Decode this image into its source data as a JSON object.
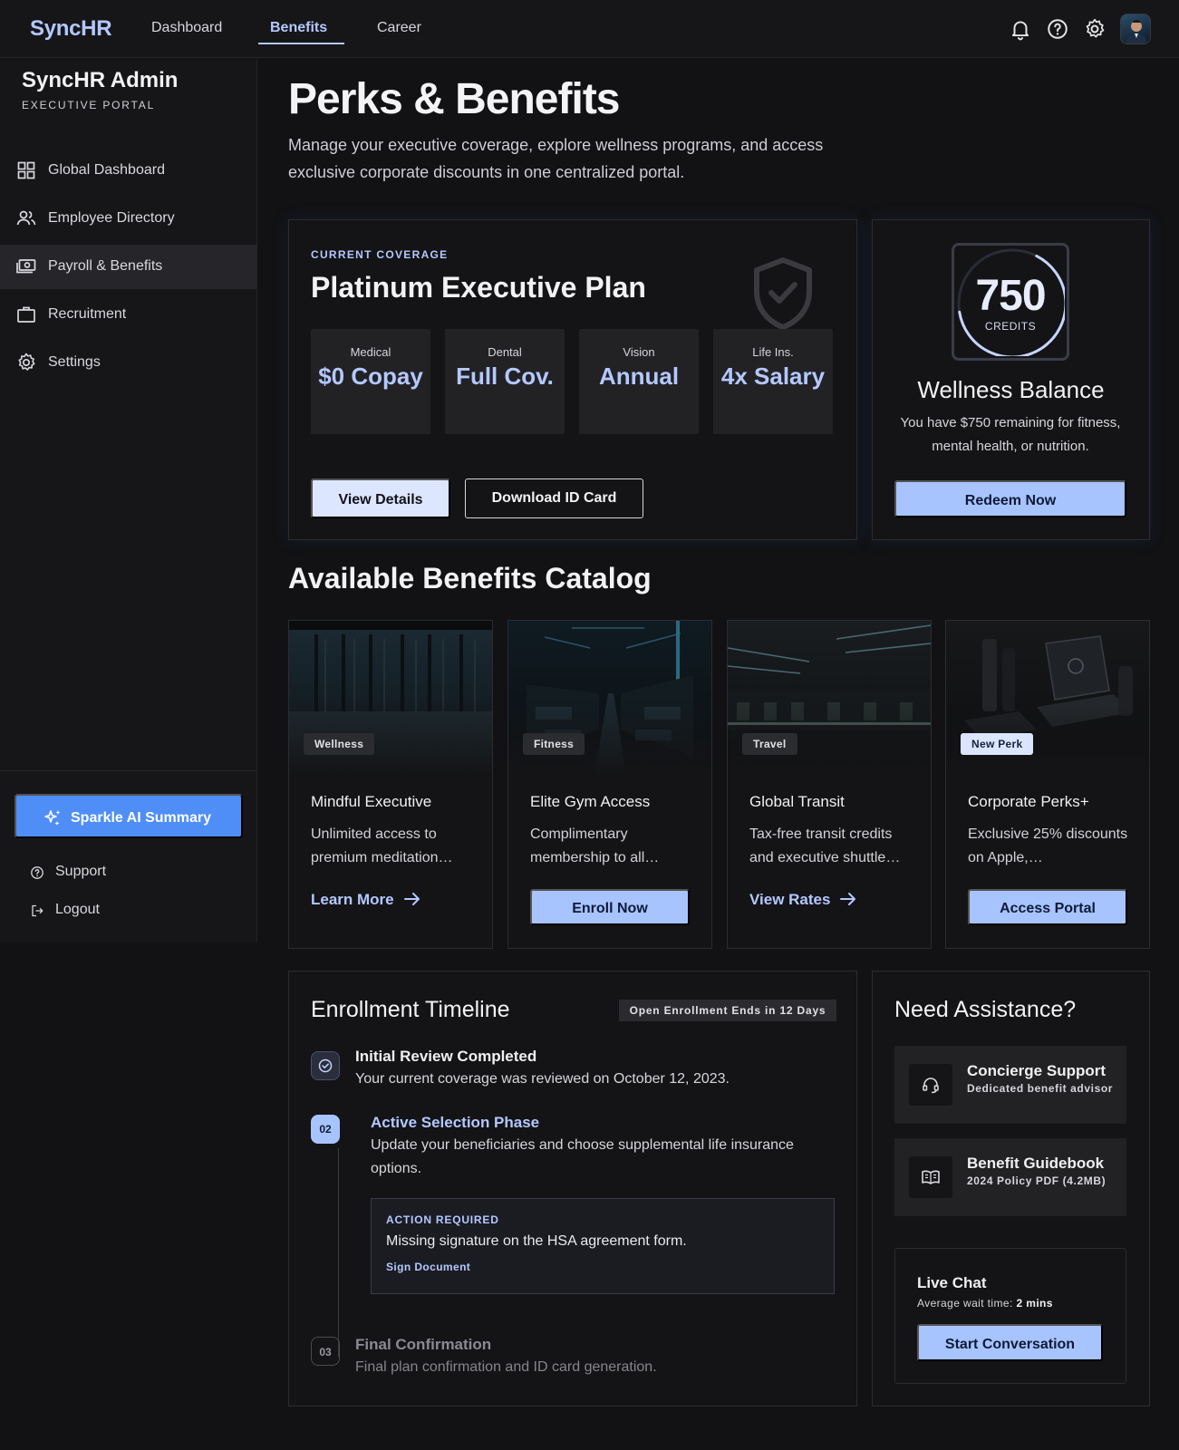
{
  "header": {
    "brand": "SyncHR",
    "nav": [
      {
        "label": "Dashboard",
        "active": false
      },
      {
        "label": "Benefits",
        "active": true
      },
      {
        "label": "Career",
        "active": false
      }
    ],
    "icons": [
      "bell-icon",
      "help-icon",
      "gear-icon",
      "avatar"
    ]
  },
  "sidebar": {
    "title": "SyncHR Admin",
    "subtitle": "EXECUTIVE PORTAL",
    "items": [
      {
        "label": "Global Dashboard",
        "icon": "grid-icon",
        "active": false
      },
      {
        "label": "Employee Directory",
        "icon": "users-icon",
        "active": false
      },
      {
        "label": "Payroll & Benefits",
        "icon": "payments-icon",
        "active": true
      },
      {
        "label": "Recruitment",
        "icon": "briefcase-icon",
        "active": false
      },
      {
        "label": "Settings",
        "icon": "gear-icon",
        "active": false
      }
    ],
    "ai_button": "Sparkle AI Summary",
    "footer": [
      {
        "label": "Support",
        "icon": "help-circle-icon"
      },
      {
        "label": "Logout",
        "icon": "logout-icon"
      }
    ]
  },
  "page": {
    "title": "Perks & Benefits",
    "description": "Manage your executive coverage, explore wellness programs, and access exclusive corporate discounts in one centralized portal."
  },
  "coverage": {
    "eyebrow": "CURRENT COVERAGE",
    "plan": "Platinum Executive Plan",
    "stats": [
      {
        "label": "Medical",
        "value": "$0 Copay"
      },
      {
        "label": "Dental",
        "value": "Full Cov."
      },
      {
        "label": "Vision",
        "value": "Annual"
      },
      {
        "label": "Life Ins.",
        "value": "4x Salary"
      }
    ],
    "view_details": "View Details",
    "download": "Download ID Card"
  },
  "wellness": {
    "credits": "750",
    "credits_label": "CREDITS",
    "title": "Wellness Balance",
    "description": "You have $750 remaining for fitness, mental health, or nutrition.",
    "button": "Redeem Now"
  },
  "catalog": {
    "title": "Available Benefits Catalog",
    "cards": [
      {
        "badge": "Wellness",
        "title": "Mindful Executive",
        "description": "Unlimited access to premium meditation…",
        "action": "Learn More",
        "action_type": "link"
      },
      {
        "badge": "Fitness",
        "title": "Elite Gym Access",
        "description": "Complimentary membership to all…",
        "action": "Enroll Now",
        "action_type": "button"
      },
      {
        "badge": "Travel",
        "title": "Global Transit",
        "description": "Tax-free transit credits and executive shuttle…",
        "action": "View Rates",
        "action_type": "link"
      },
      {
        "badge": "New Perk",
        "title": "Corporate Perks+",
        "description": "Exclusive 25% discounts on Apple,…",
        "action": "Access Portal",
        "action_type": "button"
      }
    ]
  },
  "timeline": {
    "title": "Enrollment Timeline",
    "pill": "Open Enrollment Ends in 12 Days",
    "steps": [
      {
        "marker": "",
        "title": "Initial Review Completed",
        "description": "Your current coverage was reviewed on October 12, 2023."
      },
      {
        "marker": "02",
        "title": "Active Selection Phase",
        "description": "Update your beneficiaries and choose supplemental life insurance options."
      },
      {
        "marker": "03",
        "title": "Final Confirmation",
        "description": "Final plan confirmation and ID card generation."
      }
    ],
    "action": {
      "eyebrow": "ACTION REQUIRED",
      "text": "Missing signature on the HSA agreement form.",
      "link": "Sign Document"
    }
  },
  "assistance": {
    "title": "Need Assistance?",
    "items": [
      {
        "title": "Concierge Support",
        "subtitle": "Dedicated benefit advisor",
        "icon": "headset-icon"
      },
      {
        "title": "Benefit Guidebook",
        "subtitle": "2024 Policy PDF (4.2MB)",
        "icon": "book-icon"
      }
    ],
    "chat": {
      "title": "Live Chat",
      "wait_label": "Average wait time:",
      "wait_value": "2 mins",
      "button": "Start Conversation"
    }
  },
  "colors": {
    "accent": "#b4c8ff",
    "button_blue": "#a8c4ff",
    "ai_button": "#4f8ef7",
    "background": "#121214"
  }
}
